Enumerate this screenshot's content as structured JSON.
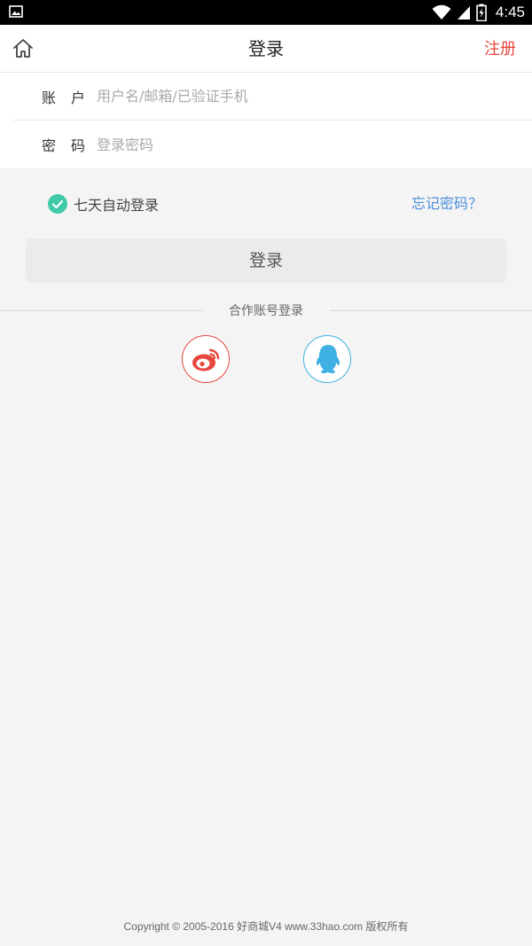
{
  "status_bar": {
    "time": "4:45"
  },
  "header": {
    "title": "登录",
    "register_label": "注册"
  },
  "form": {
    "account_label": "账户",
    "account_placeholder": "用户名/邮箱/已验证手机",
    "account_value": "",
    "password_label": "密码",
    "password_placeholder": "登录密码",
    "password_value": ""
  },
  "options": {
    "remember_label": "七天自动登录",
    "remember_checked": true,
    "forgot_label": "忘记密码？"
  },
  "login_button_label": "登录",
  "partner": {
    "label": "合作账号登录",
    "providers": [
      "weibo-icon",
      "qq-icon"
    ]
  },
  "footer": {
    "copyright": "Copyright © 2005-2016 好商城V4 www.33hao.com 版权所有"
  },
  "colors": {
    "accent_red": "#e8473f",
    "link_blue": "#4a90d9",
    "check_green": "#3ec9a7",
    "qq_blue": "#3fb0e3"
  }
}
